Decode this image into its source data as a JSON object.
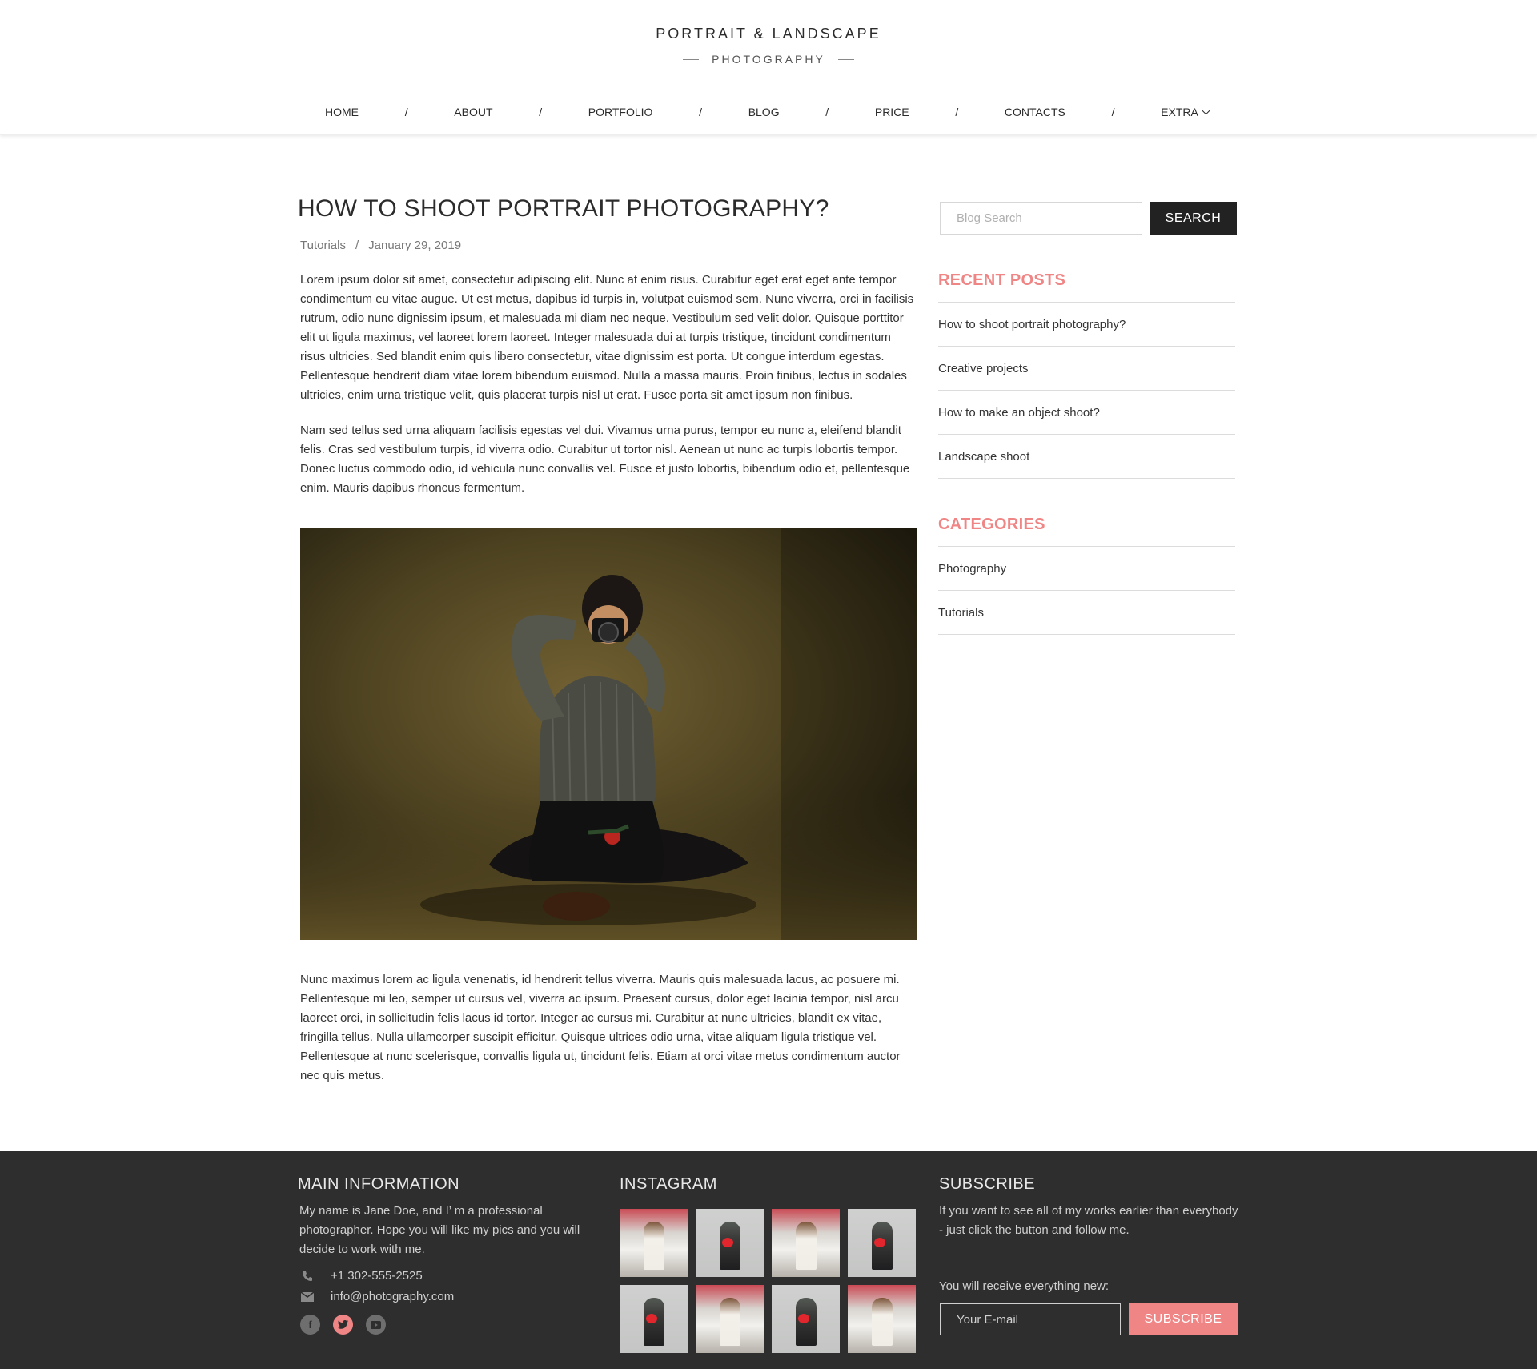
{
  "header": {
    "logo_title": "PORTRAIT & LANDSCAPE",
    "logo_subtitle": "PHOTOGRAPHY"
  },
  "nav": {
    "items": [
      "HOME",
      "ABOUT",
      "PORTFOLIO",
      "BLOG",
      "PRICE",
      "CONTACTS",
      "EXTRA"
    ],
    "separator": "/"
  },
  "article": {
    "title": "HOW TO SHOOT PORTRAIT PHOTOGRAPHY?",
    "category": "Tutorials",
    "meta_separator": "/",
    "date": "January 29, 2019",
    "paragraphs": [
      "Lorem ipsum dolor sit amet, consectetur adipiscing elit. Nunc at enim risus. Curabitur eget erat eget ante tempor condimentum eu vitae augue. Ut est metus, dapibus id turpis in, volutpat euismod sem. Nunc viverra, orci in facilisis rutrum, odio nunc dignissim ipsum, et malesuada mi diam nec neque. Vestibulum sed velit dolor. Quisque porttitor elit ut ligula maximus, vel laoreet lorem laoreet. Integer malesuada dui at turpis tristique, tincidunt condimentum risus ultricies. Sed blandit enim quis libero consectetur, vitae dignissim est porta. Ut congue interdum egestas. Pellentesque hendrerit diam vitae lorem bibendum euismod. Nulla a massa mauris. Proin finibus, lectus in sodales ultricies, enim urna tristique velit, quis placerat turpis nisl ut erat. Fusce porta sit amet ipsum non finibus.",
      "Nam sed tellus sed urna aliquam facilisis egestas vel dui. Vivamus urna purus, tempor eu nunc a, eleifend blandit felis. Cras sed vestibulum turpis, id viverra odio. Curabitur ut tortor nisl. Aenean ut nunc ac turpis lobortis tempor. Donec luctus commodo odio, id vehicula nunc convallis vel. Fusce et justo lobortis, bibendum odio et, pellentesque enim. Mauris dapibus rhoncus fermentum.",
      "Nunc maximus lorem ac ligula venenatis, id hendrerit tellus viverra. Mauris quis malesuada lacus, ac posuere mi. Pellentesque mi leo, semper ut cursus vel, viverra ac ipsum. Praesent cursus, dolor eget lacinia tempor, nisl arcu laoreet orci, in sollicitudin felis lacus id tortor. Integer ac cursus mi. Curabitur at nunc ultricies, blandit ex vitae, fringilla tellus. Nulla ullamcorper suscipit efficitur. Quisque ultrices odio urna, vitae aliquam ligula tristique vel. Pellentesque at nunc scelerisque, convallis ligula ut, tincidunt felis. Etiam at orci vitae metus condimentum auctor nec quis metus."
    ]
  },
  "sidebar": {
    "search_placeholder": "Blog Search",
    "search_button": "SEARCH",
    "recent_title": "RECENT POSTS",
    "recent_posts": [
      "How to shoot portrait photography?",
      "Creative projects",
      "How to make an object shoot?",
      "Landscape shoot"
    ],
    "categories_title": "CATEGORIES",
    "categories": [
      "Photography",
      "Tutorials"
    ]
  },
  "footer": {
    "main_title": "MAIN INFORMATION",
    "main_text": "My name is Jane Doe, and I’ m a professional photographer. Hope you will like my pics and you will decide to work with me.",
    "phone": "+1 302-555-2525",
    "email": "info@photography.com",
    "social_icons": [
      "facebook-icon",
      "twitter-icon",
      "youtube-icon"
    ],
    "instagram_title": "INSTAGRAM",
    "instagram_tiles": [
      "woman",
      "man",
      "woman",
      "man",
      "man",
      "woman",
      "man",
      "woman"
    ],
    "subscribe_title": "SUBSCRIBE",
    "subscribe_text": "If you want to see all of my works earlier than everybody - just click the button and follow me.",
    "receive_text": "You will receive everything new:",
    "email_placeholder": "Your E-mail",
    "subscribe_button": "SUBSCRIBE"
  },
  "colors": {
    "accent": "#f08585",
    "dark": "#222222",
    "footer_bg": "#2e2e2e"
  }
}
